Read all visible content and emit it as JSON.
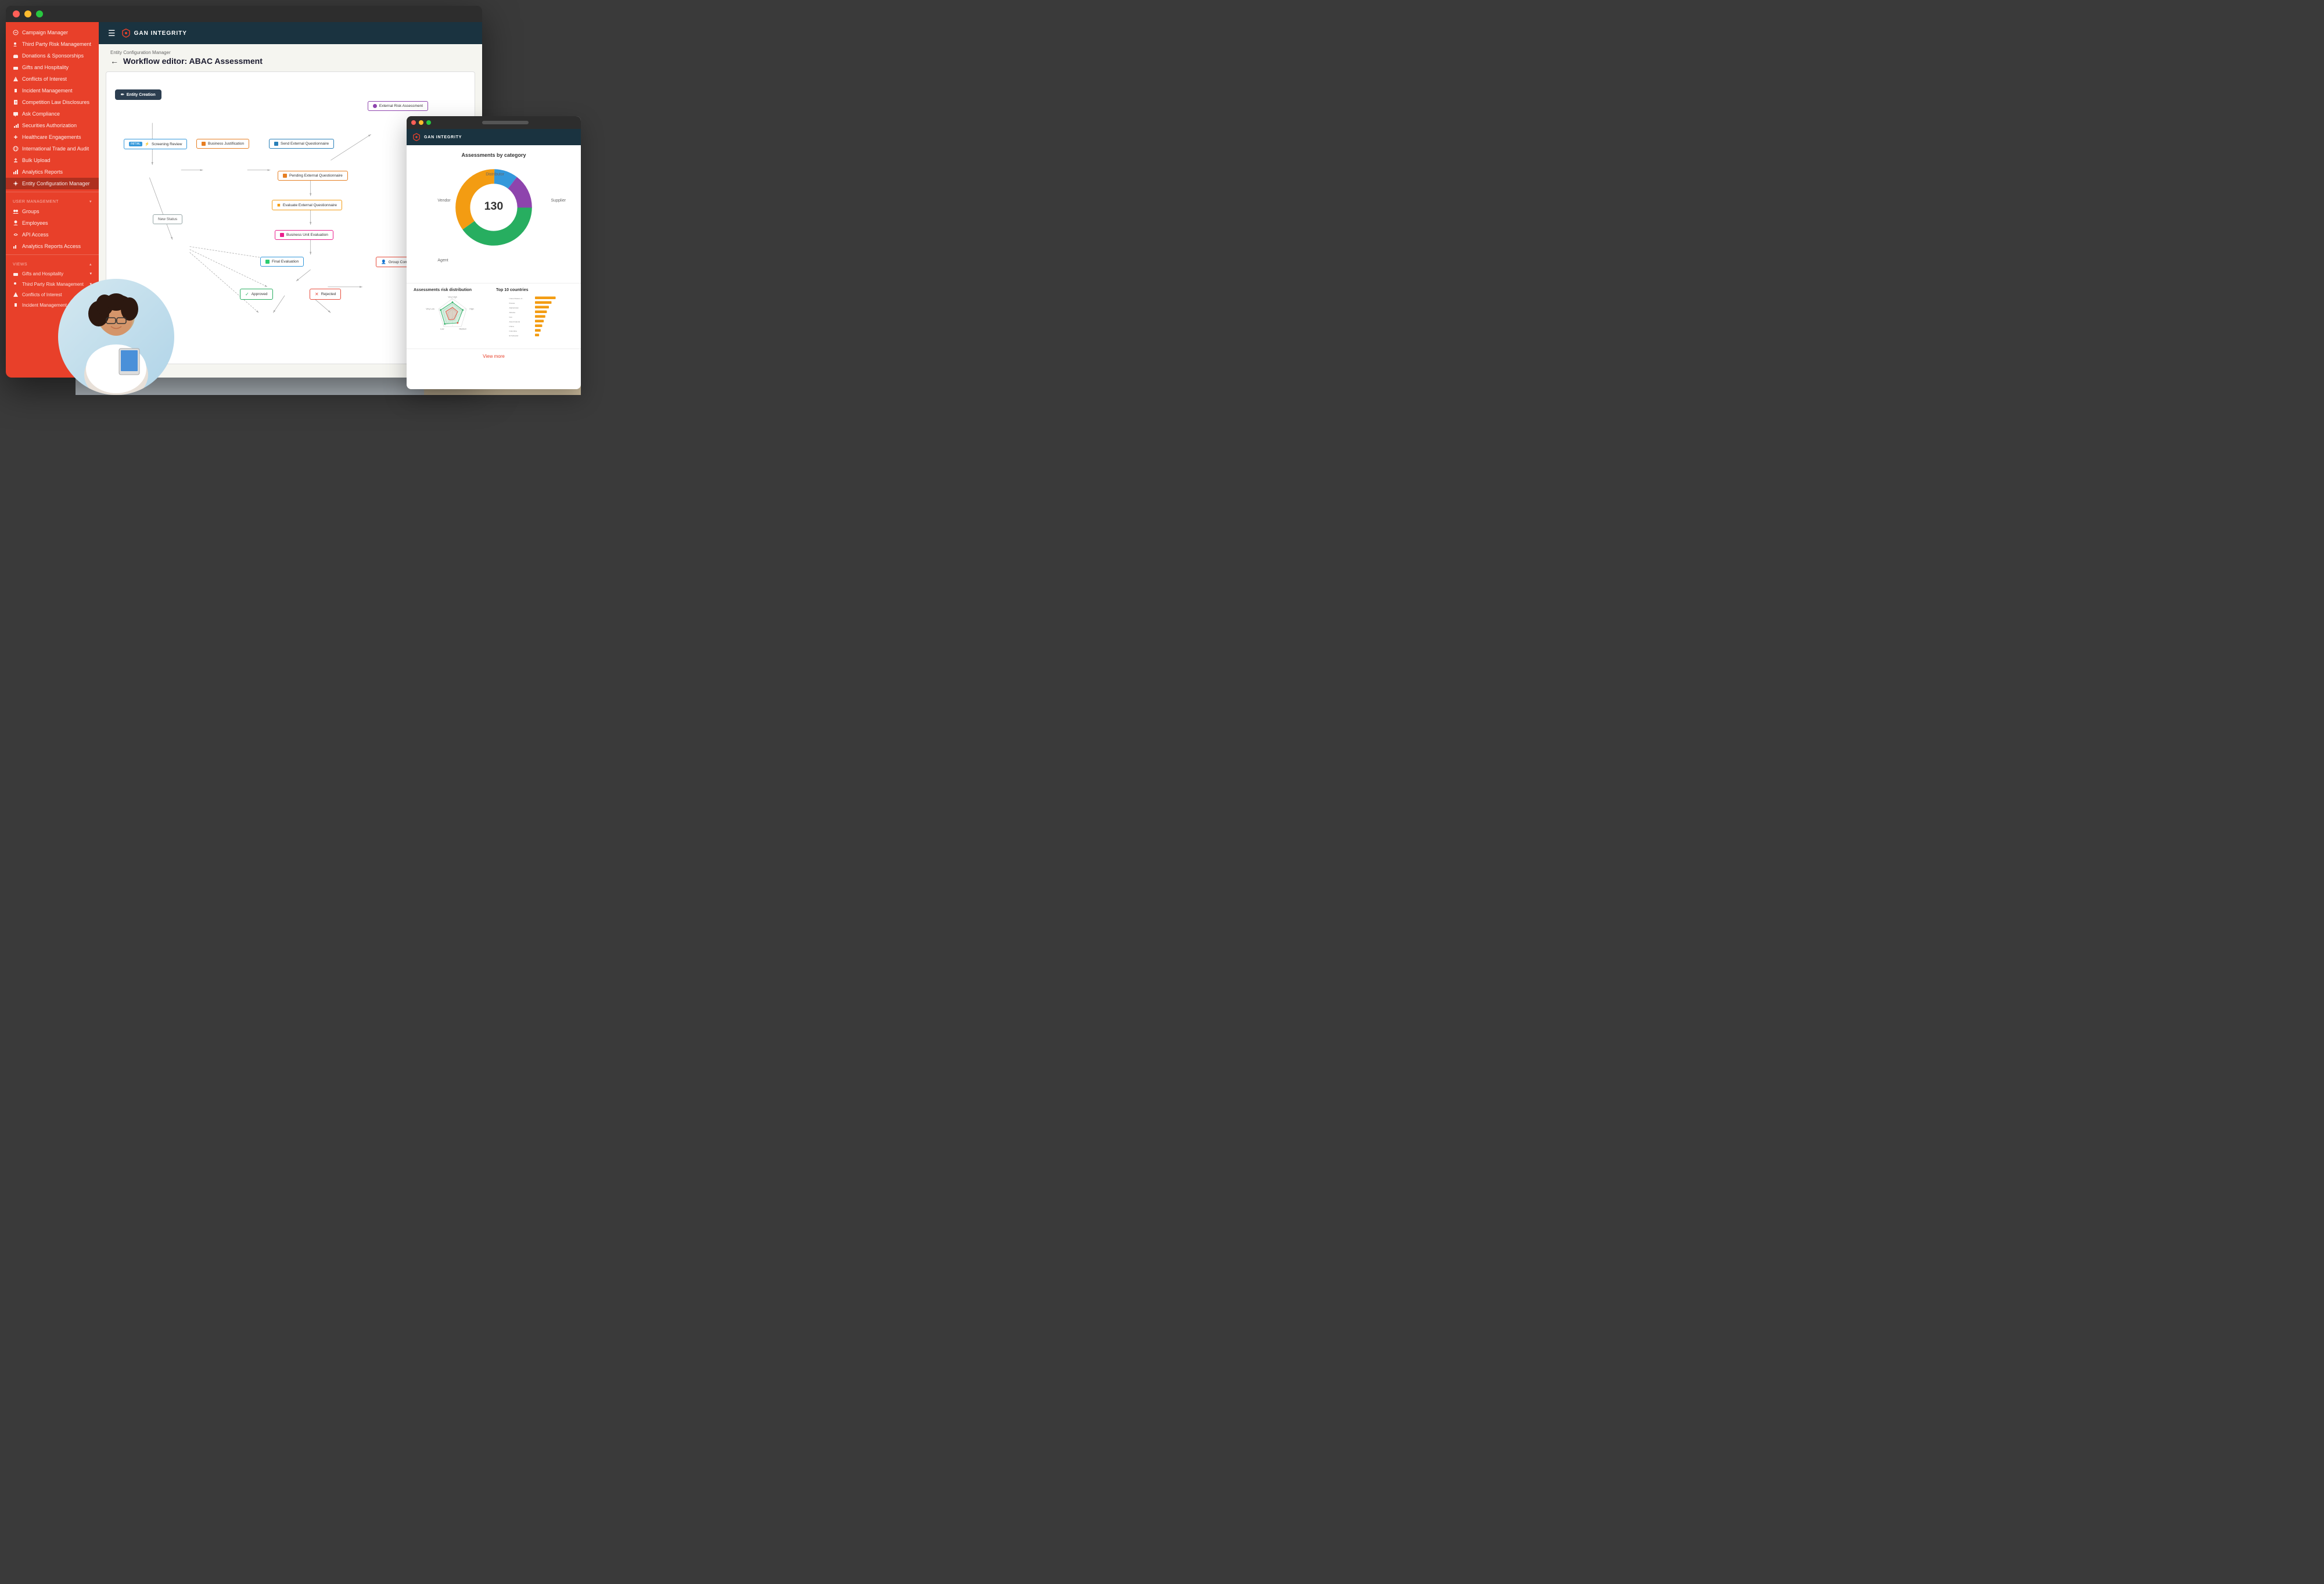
{
  "app": {
    "title": "GAN INTEGRITY",
    "brand_logo": "shield"
  },
  "mac_buttons": {
    "close": "close",
    "minimize": "minimize",
    "maximize": "maximize"
  },
  "sidebar": {
    "items": [
      {
        "label": "Campaign Manager",
        "icon": "megaphone"
      },
      {
        "label": "Third Party Risk Management",
        "icon": "users"
      },
      {
        "label": "Donations & Sponsorships",
        "icon": "gift"
      },
      {
        "label": "Gifts and Hospitality",
        "icon": "gift"
      },
      {
        "label": "Conflicts of Interest",
        "icon": "alert"
      },
      {
        "label": "Incident Management",
        "icon": "warning"
      },
      {
        "label": "Competition Law Disclosures",
        "icon": "doc"
      },
      {
        "label": "Ask Compliance",
        "icon": "chat"
      },
      {
        "label": "Securities Authorization",
        "icon": "chart"
      },
      {
        "label": "Healthcare Engagements",
        "icon": "medical"
      },
      {
        "label": "International Trade and Audit",
        "icon": "globe"
      },
      {
        "label": "Bulk Upload",
        "icon": "upload"
      },
      {
        "label": "Analytics Reports",
        "icon": "bar-chart"
      },
      {
        "label": "Entity Configuration Manager",
        "icon": "settings"
      }
    ],
    "user_management": {
      "title": "USER MANAGEMENT",
      "items": [
        {
          "label": "Groups",
          "icon": "groups"
        },
        {
          "label": "Employees",
          "icon": "employees"
        },
        {
          "label": "API Access",
          "icon": "api"
        },
        {
          "label": "Analytics Reports Access",
          "icon": "analytics"
        }
      ]
    },
    "views": {
      "title": "VIEWS",
      "items": [
        {
          "label": "Gifts and Hospitality",
          "icon": "gift",
          "has_arrow": true
        },
        {
          "label": "Third Party Risk Management",
          "icon": "users",
          "has_arrow": true
        },
        {
          "label": "Conflicts of Interest",
          "icon": "alert",
          "has_arrow": true
        },
        {
          "label": "Incident Management",
          "icon": "warning"
        }
      ]
    }
  },
  "breadcrumb": "Entity Configuration Manager",
  "page_title": "Workflow editor: ABAC Assessment",
  "back_label": "←",
  "workflow": {
    "nodes": [
      {
        "id": "entity-creation",
        "label": "Entity Creation",
        "type": "start"
      },
      {
        "id": "screening-review",
        "label": "Screening Review",
        "type": "blue",
        "badge": "INITIAL"
      },
      {
        "id": "business-justification",
        "label": "Business Justification",
        "type": "orange"
      },
      {
        "id": "send-external-questionnaire",
        "label": "Send External Questionnaire",
        "type": "blue"
      },
      {
        "id": "external-risk-assessment",
        "label": "External Risk Assessment",
        "type": "purple"
      },
      {
        "id": "pending-external",
        "label": "Pending External Questionnaire",
        "type": "orange"
      },
      {
        "id": "evaluate-external",
        "label": "Evaluate External Questionnaire",
        "type": "yellow"
      },
      {
        "id": "new-status",
        "label": "New Status",
        "type": "gray"
      },
      {
        "id": "business-unit-evaluation",
        "label": "Business Unit Evaluation",
        "type": "pink"
      },
      {
        "id": "final-evaluation",
        "label": "Final Evaluation",
        "type": "teal"
      },
      {
        "id": "group-compliance",
        "label": "Group Compliance",
        "type": "red"
      },
      {
        "id": "approved",
        "label": "Approved",
        "type": "green"
      },
      {
        "id": "rejected",
        "label": "Rejected",
        "type": "red"
      }
    ]
  },
  "second_panel": {
    "title": "Assessments by category",
    "total": "130",
    "donut_labels": [
      "Distributor",
      "Vendor",
      "Supplier",
      "Agent"
    ],
    "donut_colors": [
      "#3498db",
      "#8e44ad",
      "#f39c12",
      "#27ae60"
    ],
    "donut_segments": [
      10,
      15,
      35,
      40
    ],
    "sub_charts": {
      "left_title": "Assessments risk distribution",
      "right_title": "Top 10 countries",
      "countries": [
        "United States of...",
        "Russia",
        "Afghanistan",
        "Albania",
        "Iran",
        "Aland Islands",
        "China",
        "Colombia",
        "El Salvador"
      ]
    },
    "view_more": "View more"
  }
}
